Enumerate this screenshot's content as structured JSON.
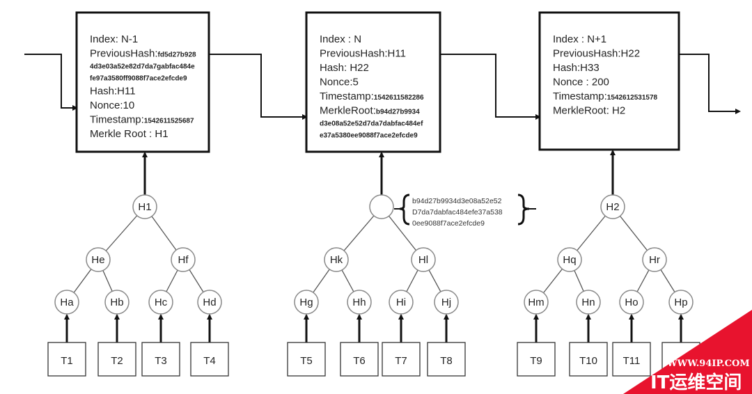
{
  "blocks": [
    {
      "lines": [
        {
          "label": "Index: N-1",
          "value": ""
        },
        {
          "label": "PreviousHash:",
          "value": "fd5d27b928"
        },
        {
          "label": "",
          "value": "4d3e03a52e82d7da7gabfac484e"
        },
        {
          "label": "",
          "value": "fe97a3580ff9088f7ace2efcde9"
        },
        {
          "label": "Hash:H11",
          "value": ""
        },
        {
          "label": "Nonce:10",
          "value": ""
        },
        {
          "label": "Timestamp:",
          "value": "1542611525687"
        },
        {
          "label": "Merkle Root : H1",
          "value": ""
        }
      ]
    },
    {
      "lines": [
        {
          "label": "Index : N",
          "value": ""
        },
        {
          "label": "PreviousHash:H11",
          "value": ""
        },
        {
          "label": "Hash: H22",
          "value": ""
        },
        {
          "label": "Nonce:5",
          "value": ""
        },
        {
          "label": "Timestamp:",
          "value": "1542611582286"
        },
        {
          "label": "MerkleRoot:",
          "value": "b94d27b9934"
        },
        {
          "label": "",
          "value": "d3e08a52e52d7da7dabfac484ef"
        },
        {
          "label": "",
          "value": "e37a5380ee9088f7ace2efcde9"
        }
      ]
    },
    {
      "lines": [
        {
          "label": "Index : N+1",
          "value": ""
        },
        {
          "label": "PreviousHash:H22",
          "value": ""
        },
        {
          "label": "Hash:H33",
          "value": ""
        },
        {
          "label": "Nonce : 200",
          "value": ""
        },
        {
          "label": "Timestamp:",
          "value": "1542612531578"
        },
        {
          "label": "MerkleRoot: H2",
          "value": ""
        }
      ]
    }
  ],
  "trees": [
    {
      "root": "H1",
      "mid": [
        "He",
        "Hf"
      ],
      "leaves": [
        "Ha",
        "Hb",
        "Hc",
        "Hd"
      ],
      "tx": [
        "T1",
        "T2",
        "T3",
        "T4"
      ]
    },
    {
      "root": "",
      "mid": [
        "Hk",
        "Hl"
      ],
      "leaves": [
        "Hg",
        "Hh",
        "Hi",
        "Hj"
      ],
      "tx": [
        "T5",
        "T6",
        "T7",
        "T8"
      ]
    },
    {
      "root": "H2",
      "mid": [
        "Hq",
        "Hr"
      ],
      "leaves": [
        "Hm",
        "Hn",
        "Ho",
        "Hp"
      ],
      "tx": [
        "T9",
        "T10",
        "T11",
        ""
      ]
    }
  ],
  "root_note": [
    "b94d27b9934d3e08a52e52",
    "D7da7dabfac484efe37a538",
    "0ee9088f7ace2efcde9"
  ],
  "watermark": {
    "url": "WWW.94IP.COM",
    "name": "IT运维空间",
    "color": "#e8132e"
  }
}
